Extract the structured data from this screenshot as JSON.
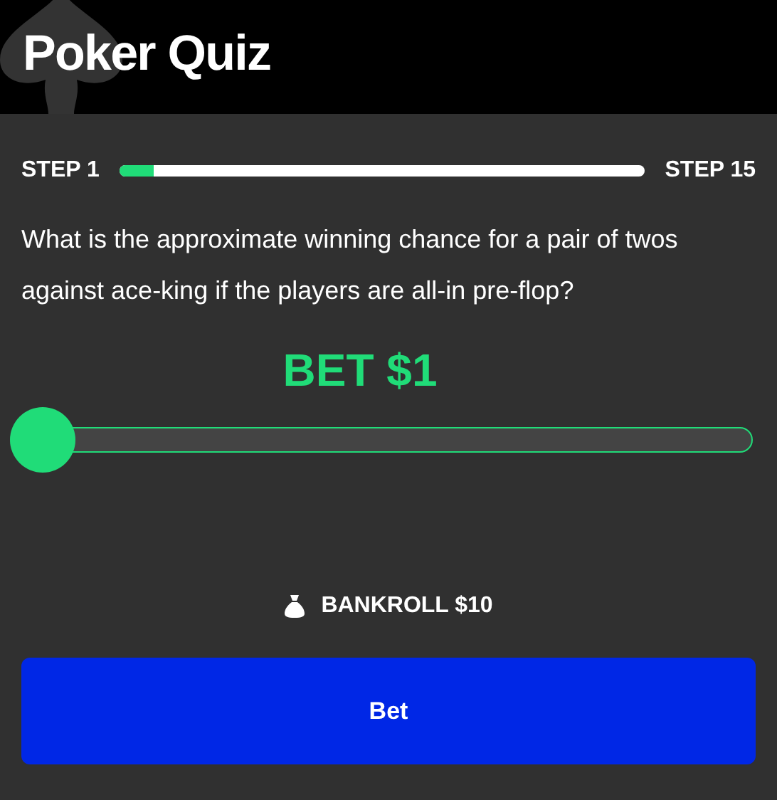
{
  "header": {
    "title": "Poker Quiz"
  },
  "progress": {
    "start_label": "STEP 1",
    "end_label": "STEP 15",
    "level": 0.065
  },
  "question": "What is the approximate winning chance for a pair of twos against ace-king if the players are all-in pre-flop?",
  "bet": {
    "label": "BET $1",
    "level": 0
  },
  "bankroll": "BANKROLL $10",
  "button": "Bet"
}
